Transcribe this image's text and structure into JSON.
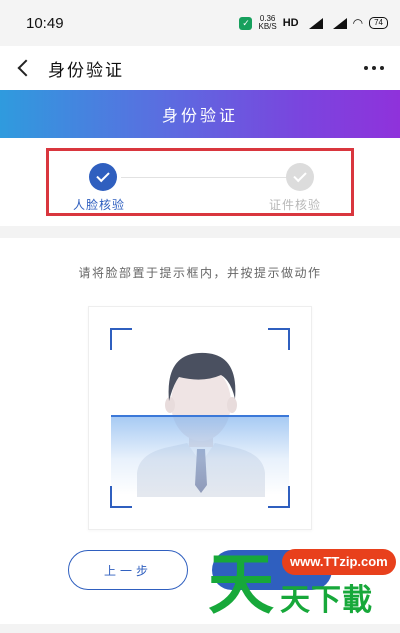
{
  "status_bar": {
    "time": "10:49",
    "speed_value": "0.36",
    "speed_unit": "KB/S",
    "hd_label": "HD",
    "battery": "74",
    "icons": [
      "shield-icon",
      "signal-icon",
      "wifi-icon",
      "battery-icon"
    ]
  },
  "header": {
    "title": "身份验证",
    "back_icon": "chevron-left-icon",
    "more_icon": "more-dots-icon"
  },
  "banner": {
    "title": "身份验证"
  },
  "steps": [
    {
      "label": "人脸核验",
      "state": "active"
    },
    {
      "label": "证件核验",
      "state": "inactive"
    }
  ],
  "face_capture": {
    "instruction": "请将脸部置于提示框内，并按提示做动作"
  },
  "actions": {
    "prev_label": "上一步",
    "next_label": ""
  },
  "watermark": {
    "logo": "天",
    "url": "www.TTzip.com",
    "text": "天下載"
  },
  "colors": {
    "accent": "#2f5fbf",
    "highlight_border": "#d9363e",
    "banner_start": "#2f9bde",
    "banner_end": "#8f32db",
    "watermark_green": "#17a83a",
    "watermark_red": "#e8401c"
  }
}
